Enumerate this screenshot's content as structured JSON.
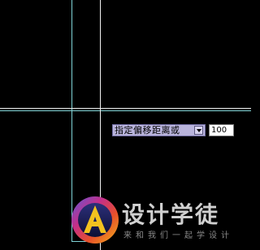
{
  "dynamic_input": {
    "prompt": "指定偏移距离或",
    "value": "100",
    "options_icon": "dropdown-arrow-icon"
  },
  "watermark": {
    "title": "设计学徒",
    "subtitle": "来和我们一起学设计",
    "logo_icon": "circle-a-logo-icon"
  },
  "colors": {
    "background": "#000000",
    "guide_lines": "#7fd3d6",
    "crosshair": "#f2f2f2",
    "prompt_background": "#b9b4dc",
    "input_background": "#ffffff"
  }
}
